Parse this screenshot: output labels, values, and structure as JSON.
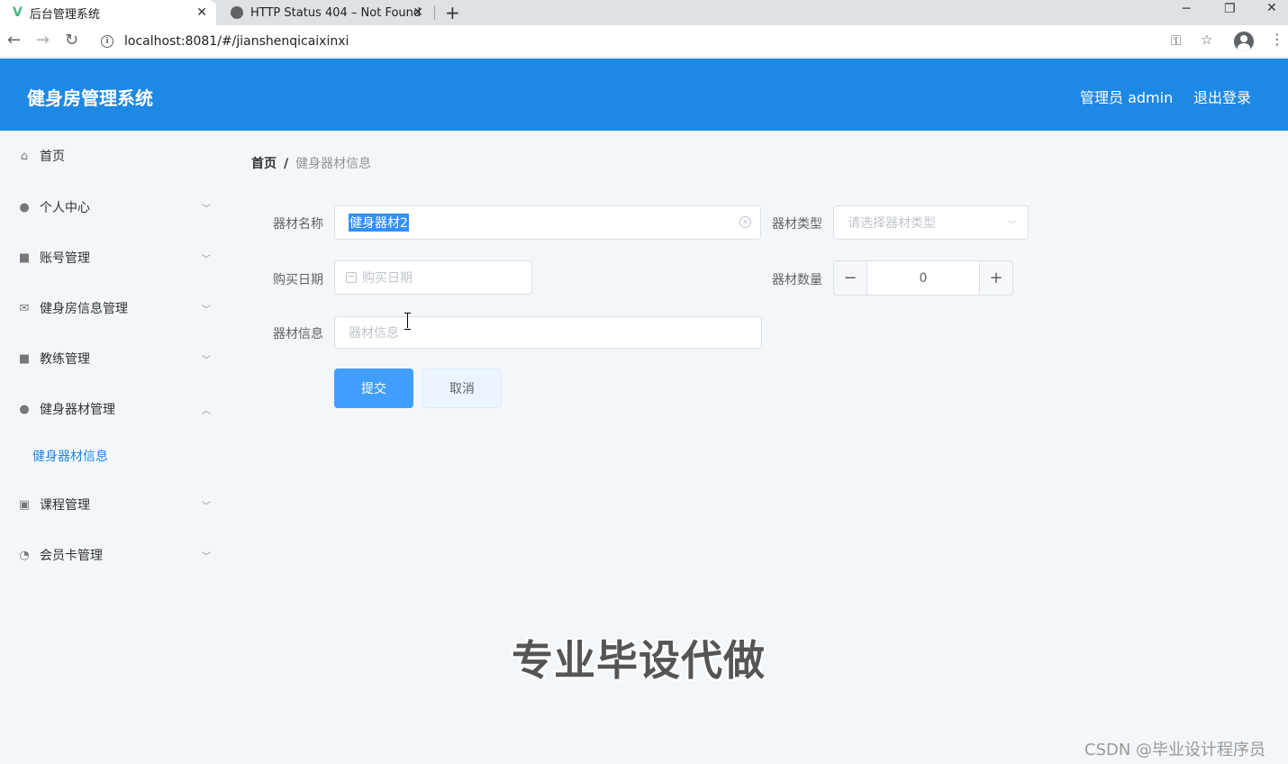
{
  "browser": {
    "tabs": [
      {
        "title": "后台管理系统",
        "active": true
      },
      {
        "title": "HTTP Status 404 – Not Found",
        "active": false
      }
    ],
    "url": "localhost:8081/#/jianshenqicaixinxi",
    "close_glyph": "✕",
    "new_tab_glyph": "+",
    "minimize_glyph": "─",
    "restore_glyph": "❐",
    "window_close_glyph": "✕",
    "back_glyph": "←",
    "forward_glyph": "→",
    "reload_glyph": "↻",
    "key_glyph": "⚿",
    "star_glyph": "☆",
    "menu_glyph": "⋮"
  },
  "header": {
    "title": "健身房管理系统",
    "admin": "管理员 admin",
    "logout": "退出登录"
  },
  "sidebar": {
    "items": [
      {
        "label": "首页",
        "icon": "home-icon",
        "glyph": "⌂",
        "arrow": ""
      },
      {
        "label": "个人中心",
        "icon": "user-icon",
        "glyph": "●",
        "arrow": "﹀"
      },
      {
        "label": "账号管理",
        "icon": "wallet-icon",
        "glyph": "■",
        "arrow": "﹀"
      },
      {
        "label": "健身房信息管理",
        "icon": "mail-icon",
        "glyph": "✉",
        "arrow": "﹀"
      },
      {
        "label": "教练管理",
        "icon": "briefcase-icon",
        "glyph": "■",
        "arrow": "﹀"
      },
      {
        "label": "健身器材管理",
        "icon": "user-icon",
        "glyph": "●",
        "arrow": "︿"
      },
      {
        "label": "课程管理",
        "icon": "clipboard-icon",
        "glyph": "▣",
        "arrow": "﹀"
      },
      {
        "label": "会员卡管理",
        "icon": "gauge-icon",
        "glyph": "◔",
        "arrow": "﹀"
      }
    ],
    "sub_item": "健身器材信息"
  },
  "breadcrumb": {
    "home": "首页",
    "sep": "/",
    "current": "健身器材信息"
  },
  "form": {
    "name_label": "器材名称",
    "name_value": "健身器材2",
    "type_label": "器材类型",
    "type_placeholder": "请选择器材类型",
    "date_label": "购买日期",
    "date_placeholder": "购买日期",
    "qty_label": "器材数量",
    "qty_value": "0",
    "qty_minus": "−",
    "qty_plus": "+",
    "info_label": "器材信息",
    "info_placeholder": "器材信息",
    "submit": "提交",
    "cancel": "取消",
    "select_arrow": "﹀",
    "clear_glyph": "✕"
  },
  "overlay": {
    "watermark": "专业毕设代做",
    "credit": "CSDN @毕业设计程序员"
  }
}
